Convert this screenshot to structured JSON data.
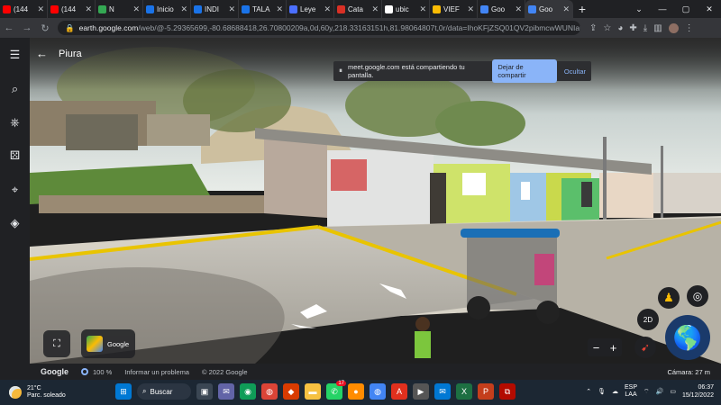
{
  "browser": {
    "tabs": [
      {
        "label": "(144",
        "favicon_color": "#ff0000",
        "favicon": "youtube-icon"
      },
      {
        "label": "(144",
        "favicon_color": "#ff0000",
        "favicon": "youtube-icon"
      },
      {
        "label": "N",
        "favicon_color": "#34a853",
        "favicon": "record-icon"
      },
      {
        "label": "Inicio",
        "favicon_color": "#1a73e8",
        "favicon": "site-icon"
      },
      {
        "label": "INDI",
        "favicon_color": "#1a73e8",
        "favicon": "site-icon"
      },
      {
        "label": "TALA",
        "favicon_color": "#1a73e8",
        "favicon": "site-icon"
      },
      {
        "label": "Leye",
        "favicon_color": "#4b6fff",
        "favicon": "doc-icon"
      },
      {
        "label": "Cata",
        "favicon_color": "#d93025",
        "favicon": "pdf-icon"
      },
      {
        "label": "ubic",
        "favicon_color": "#ffffff",
        "favicon": "google-icon"
      },
      {
        "label": "VIEF",
        "favicon_color": "#fbbc04",
        "favicon": "drive-icon"
      },
      {
        "label": "Goo",
        "favicon_color": "#4285f4",
        "favicon": "earth-icon"
      },
      {
        "label": "Goo",
        "favicon_color": "#4285f4",
        "favicon": "earth-icon"
      }
    ],
    "address": {
      "host": "earth.google.com",
      "path": "/web/@-5.29365699,-80.68688418,26.70800209a,0d,60y,218.33163151h,81.98064807t,0r/data=IhoKFjZSQ01QV2pibmcwWUNIaFhWn..."
    }
  },
  "earth": {
    "place_title": "Piura",
    "screen_share": {
      "message": "meet.google.com está compartiendo tu pantalla.",
      "stop_label": "Dejar de compartir",
      "hide_label": "Ocultar"
    },
    "layer_label": "Google",
    "view_mode": "2D",
    "status": {
      "brand": "Google",
      "zoom_percent": "100 %",
      "report": "Informar un problema",
      "copyright": "© 2022 Google",
      "camera": "Cámara: 27 m"
    }
  },
  "taskbar": {
    "weather_temp": "21°C",
    "weather_desc": "Parc. soleado",
    "search_label": "Buscar",
    "notification_count": "17",
    "lang_top": "ESP",
    "lang_bottom": "LAA",
    "time": "06:37",
    "date": "15/12/2022"
  }
}
